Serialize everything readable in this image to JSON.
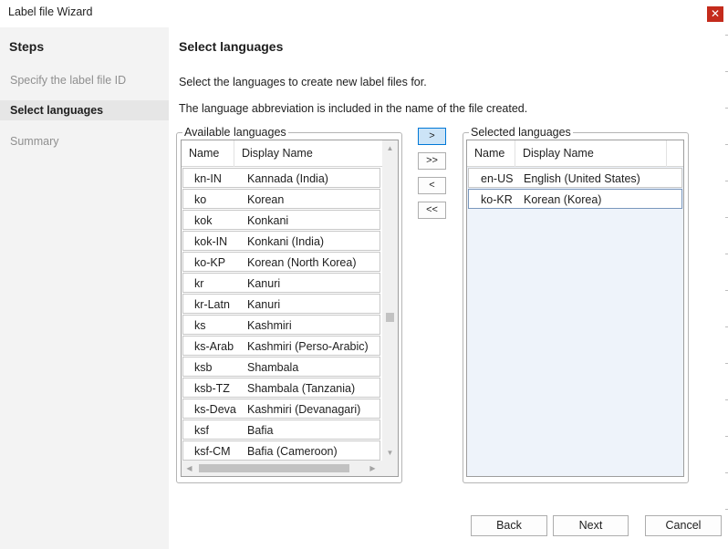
{
  "window": {
    "title": "Label file Wizard",
    "close_icon": "✕"
  },
  "steps": {
    "title": "Steps",
    "items": [
      {
        "label": "Specify the label file ID",
        "active": false
      },
      {
        "label": "Select languages",
        "active": true
      },
      {
        "label": "Summary",
        "active": false
      }
    ]
  },
  "main": {
    "title": "Select languages",
    "description": "Select the languages to create new label files for.",
    "note": "The language abbreviation is included in the name of the file created."
  },
  "available": {
    "legend": "Available languages",
    "columns": [
      "Name",
      "Display Name"
    ],
    "rows": [
      {
        "name": "kn-IN",
        "display": "Kannada (India)"
      },
      {
        "name": "ko",
        "display": "Korean"
      },
      {
        "name": "kok",
        "display": "Konkani"
      },
      {
        "name": "kok-IN",
        "display": "Konkani (India)"
      },
      {
        "name": "ko-KP",
        "display": "Korean (North Korea)"
      },
      {
        "name": "kr",
        "display": "Kanuri"
      },
      {
        "name": "kr-Latn",
        "display": "Kanuri"
      },
      {
        "name": "ks",
        "display": "Kashmiri"
      },
      {
        "name": "ks-Arab",
        "display": "Kashmiri (Perso-Arabic)"
      },
      {
        "name": "ksb",
        "display": "Shambala"
      },
      {
        "name": "ksb-TZ",
        "display": "Shambala (Tanzania)"
      },
      {
        "name": "ks-Deva",
        "display": "Kashmiri (Devanagari)"
      },
      {
        "name": "ksf",
        "display": "Bafia"
      },
      {
        "name": "ksf-CM",
        "display": "Bafia (Cameroon)"
      }
    ]
  },
  "selected": {
    "legend": "Selected languages",
    "columns": [
      "Name",
      "Display Name"
    ],
    "rows": [
      {
        "name": "en-US",
        "display": "English (United States)"
      },
      {
        "name": "ko-KR",
        "display": "Korean (Korea)"
      }
    ]
  },
  "move_buttons": {
    "add": ">",
    "add_all": ">>",
    "remove": "<",
    "remove_all": "<<"
  },
  "buttons": {
    "back": "Back",
    "next": "Next",
    "cancel": "Cancel"
  },
  "icons": {
    "scroll_up": "▲",
    "scroll_down": "▼",
    "scroll_left": "◀",
    "scroll_right": "▶"
  },
  "colors": {
    "close_button": "#c42b1c",
    "selected_border": "#0078d7",
    "steps_background": "#f3f3f3"
  }
}
